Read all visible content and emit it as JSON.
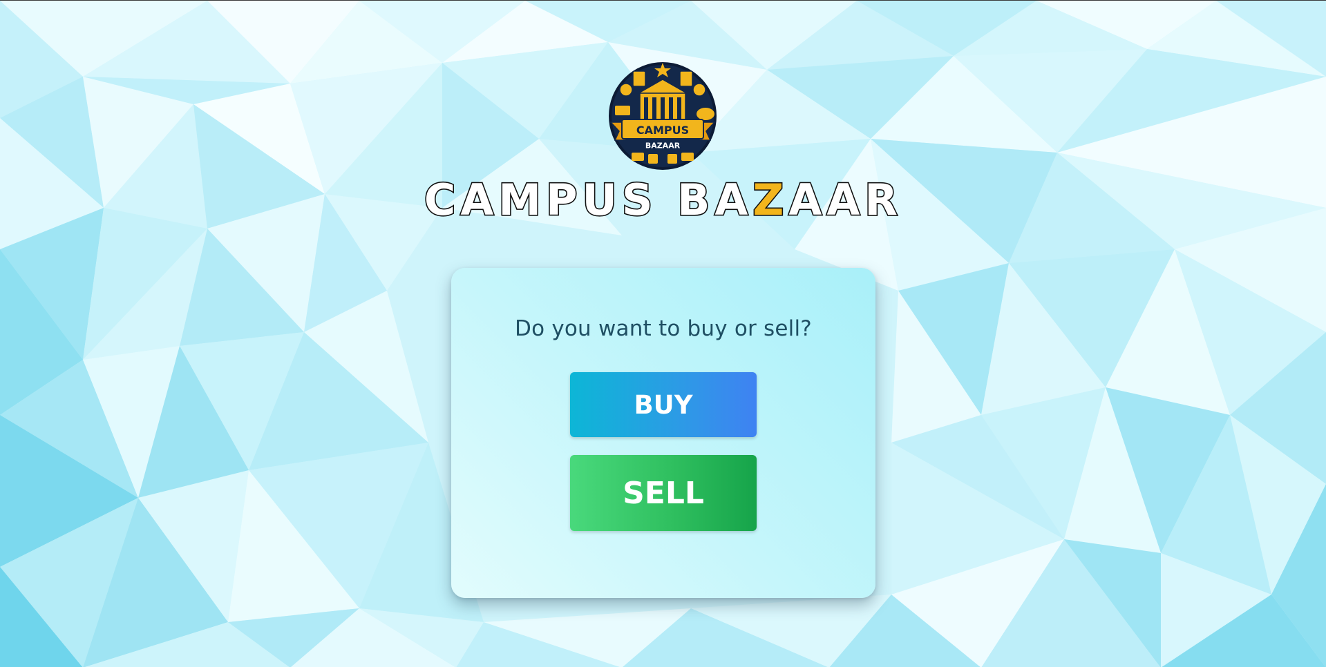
{
  "brand": {
    "logo_text_top": "CAMPUS",
    "logo_text_bottom": "BAZAAR",
    "title_part1": "CAMPUS BA",
    "title_accent": "Z",
    "title_part2": "AAR",
    "accent_color": "#f2b51c"
  },
  "card": {
    "prompt": "Do you want to buy or sell?",
    "buy_label": "BUY",
    "sell_label": "SELL"
  },
  "colors": {
    "buy_start": "#0db6d6",
    "buy_end": "#3f82f2",
    "sell_start": "#49d97c",
    "sell_end": "#16a44a",
    "background": "#cdf3fb"
  }
}
